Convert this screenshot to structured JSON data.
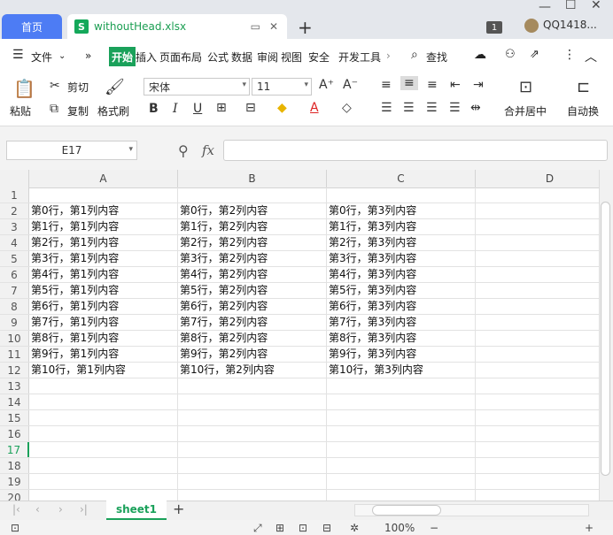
{
  "titlebar": {
    "home_tab": "首页",
    "doc_tab": "withoutHead.xlsx",
    "doc_icon_letter": "S",
    "badge": "1",
    "user": "QQ1418..."
  },
  "menu": {
    "file": "文件",
    "items": [
      "开始",
      "插入",
      "页面布局",
      "公式",
      "数据",
      "审阅",
      "视图",
      "安全",
      "开发工具"
    ],
    "search": "查找"
  },
  "ribbon": {
    "paste": "粘贴",
    "cut": "剪切",
    "copy": "复制",
    "format_painter": "格式刷",
    "font_name": "宋体",
    "font_size": "11",
    "merge_center": "合并居中",
    "auto_wrap": "自动换"
  },
  "formula": {
    "cell_ref": "E17",
    "fx": "fx"
  },
  "sheet": {
    "columns": [
      "A",
      "B",
      "C",
      "D"
    ],
    "row_numbers": [
      "1",
      "2",
      "3",
      "4",
      "5",
      "6",
      "7",
      "8",
      "9",
      "10",
      "11",
      "12",
      "13",
      "14",
      "15",
      "16",
      "17",
      "18",
      "19",
      "20"
    ],
    "active_row": "17",
    "rows": [
      [
        "",
        "",
        ""
      ],
      [
        "第0行，第1列内容",
        "第0行，第2列内容",
        "第0行，第3列内容"
      ],
      [
        "第1行，第1列内容",
        "第1行，第2列内容",
        "第1行，第3列内容"
      ],
      [
        "第2行，第1列内容",
        "第2行，第2列内容",
        "第2行，第3列内容"
      ],
      [
        "第3行，第1列内容",
        "第3行，第2列内容",
        "第3行，第3列内容"
      ],
      [
        "第4行，第1列内容",
        "第4行，第2列内容",
        "第4行，第3列内容"
      ],
      [
        "第5行，第1列内容",
        "第5行，第2列内容",
        "第5行，第3列内容"
      ],
      [
        "第6行，第1列内容",
        "第6行，第2列内容",
        "第6行，第3列内容"
      ],
      [
        "第7行，第1列内容",
        "第7行，第2列内容",
        "第7行，第3列内容"
      ],
      [
        "第8行，第1列内容",
        "第8行，第2列内容",
        "第8行，第3列内容"
      ],
      [
        "第9行，第1列内容",
        "第9行，第2列内容",
        "第9行，第3列内容"
      ],
      [
        "第10行，第1列内容",
        "第10行，第2列内容",
        "第10行，第3列内容"
      ],
      [
        "",
        "",
        ""
      ],
      [
        "",
        "",
        ""
      ],
      [
        "",
        "",
        ""
      ],
      [
        "",
        "",
        ""
      ],
      [
        "",
        "",
        ""
      ],
      [
        "",
        "",
        ""
      ],
      [
        "",
        "",
        ""
      ],
      [
        "",
        "",
        ""
      ]
    ],
    "tab_name": "sheet1"
  },
  "status": {
    "zoom": "100%"
  },
  "colors": {
    "accent_green": "#1aa15a",
    "home_tab_blue": "#4d7cf4"
  }
}
